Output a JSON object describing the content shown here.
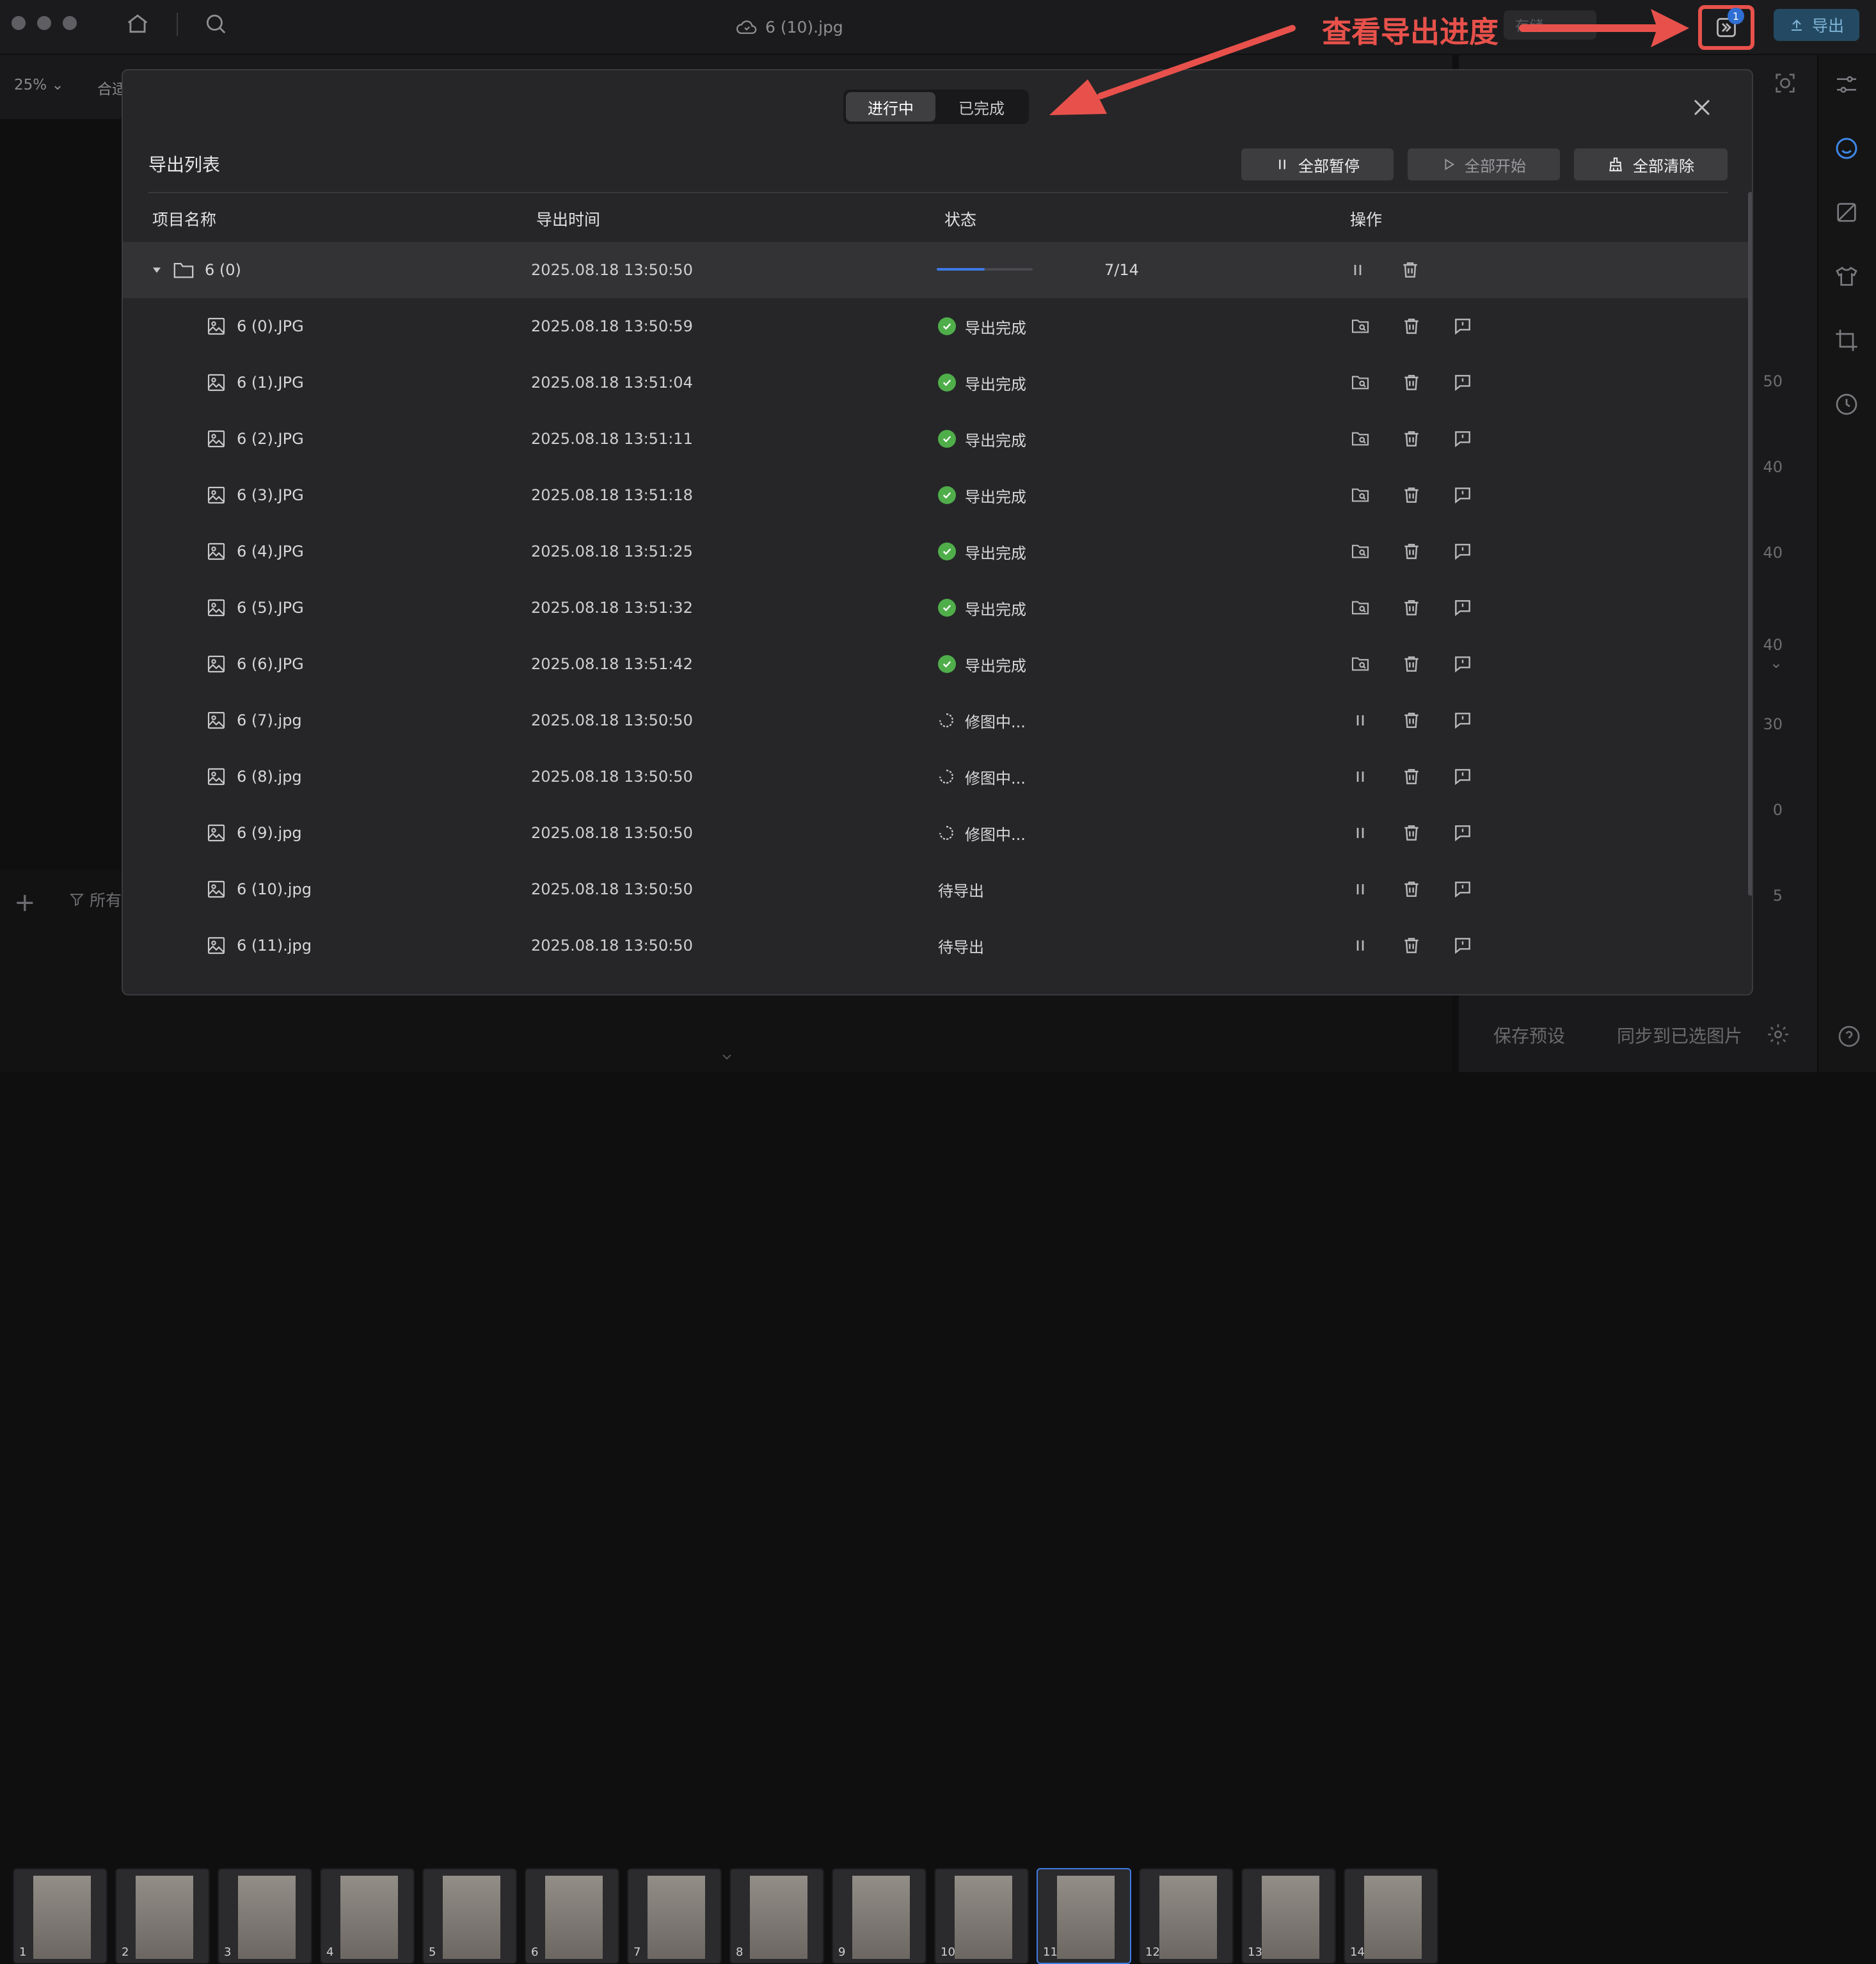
{
  "app": {
    "file_title": "6 (10).jpg",
    "zoom": "25%",
    "fit_label": "合适",
    "preset_chip": "存储",
    "export_label": "导出",
    "tasks_badge": "1",
    "filter_label": "所有",
    "save_preset": "保存预设",
    "sync_selected": "同步到已选图片",
    "side_values": [
      "50",
      "40",
      "40",
      "40",
      "30",
      "0",
      "5"
    ],
    "thumbnails": [
      "1",
      "2",
      "3",
      "4",
      "5",
      "6",
      "7",
      "8",
      "9",
      "10",
      "11",
      "12",
      "13",
      "14"
    ]
  },
  "annotation": {
    "text": "查看导出进度",
    "color": "#e8514b"
  },
  "modal": {
    "tabs": [
      {
        "label": "进行中",
        "active": true
      },
      {
        "label": "已完成",
        "active": false
      }
    ],
    "title": "导出列表",
    "actions": {
      "pause_all": "全部暂停",
      "start_all": "全部开始",
      "clear_all": "全部清除"
    },
    "columns": {
      "name": "项目名称",
      "time": "导出时间",
      "status": "状态",
      "ops": "操作"
    },
    "group": {
      "name": "6 (0)",
      "time": "2025.08.18 13:50:50",
      "progress_text": "7/14",
      "progress_done": 7,
      "progress_total": 14
    },
    "rows": [
      {
        "name": "6 (0).JPG",
        "time": "2025.08.18 13:50:59",
        "status": "导出完成",
        "state": "done"
      },
      {
        "name": "6 (1).JPG",
        "time": "2025.08.18 13:51:04",
        "status": "导出完成",
        "state": "done"
      },
      {
        "name": "6 (2).JPG",
        "time": "2025.08.18 13:51:11",
        "status": "导出完成",
        "state": "done"
      },
      {
        "name": "6 (3).JPG",
        "time": "2025.08.18 13:51:18",
        "status": "导出完成",
        "state": "done"
      },
      {
        "name": "6 (4).JPG",
        "time": "2025.08.18 13:51:25",
        "status": "导出完成",
        "state": "done"
      },
      {
        "name": "6 (5).JPG",
        "time": "2025.08.18 13:51:32",
        "status": "导出完成",
        "state": "done"
      },
      {
        "name": "6 (6).JPG",
        "time": "2025.08.18 13:51:42",
        "status": "导出完成",
        "state": "done"
      },
      {
        "name": "6 (7).jpg",
        "time": "2025.08.18 13:50:50",
        "status": "修图中...",
        "state": "processing"
      },
      {
        "name": "6 (8).jpg",
        "time": "2025.08.18 13:50:50",
        "status": "修图中...",
        "state": "processing"
      },
      {
        "name": "6 (9).jpg",
        "time": "2025.08.18 13:50:50",
        "status": "修图中...",
        "state": "processing"
      },
      {
        "name": "6 (10).jpg",
        "time": "2025.08.18 13:50:50",
        "status": "待导出",
        "state": "pending"
      },
      {
        "name": "6 (11).jpg",
        "time": "2025.08.18 13:50:50",
        "status": "待导出",
        "state": "pending"
      }
    ]
  }
}
